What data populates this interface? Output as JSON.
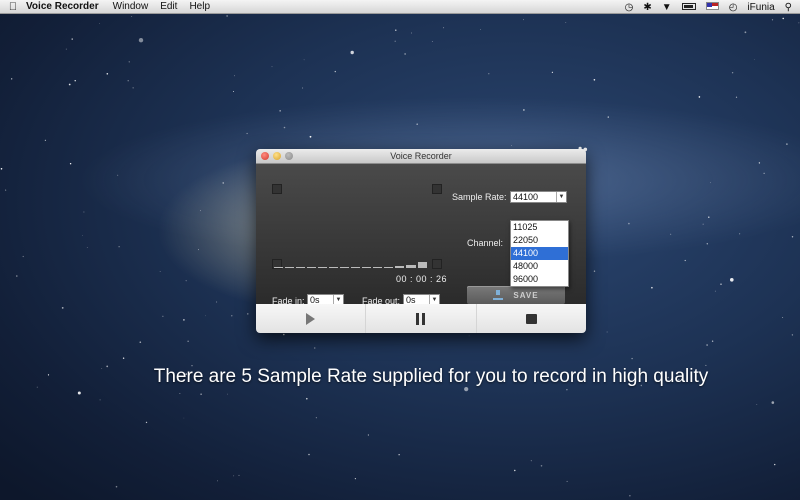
{
  "menubar": {
    "app_name": "Voice Recorder",
    "items": [
      "Window",
      "Edit",
      "Help"
    ],
    "user": "iFunia"
  },
  "window": {
    "title": "Voice Recorder",
    "sample_rate_label": "Sample Rate:",
    "sample_rate_value": "44100",
    "sample_rate_options": [
      "11025",
      "22050",
      "44100",
      "48000",
      "96000"
    ],
    "sample_rate_selected_index": 2,
    "channel_label": "Channel:",
    "timer": "00 : 00 : 26",
    "fade_in_label": "Fade in:",
    "fade_in_value": "0s",
    "fade_out_label": "Fade out:",
    "fade_out_value": "0s",
    "save_label": "SAVE"
  },
  "caption": "There are 5 Sample Rate supplied for you to record in high quality"
}
